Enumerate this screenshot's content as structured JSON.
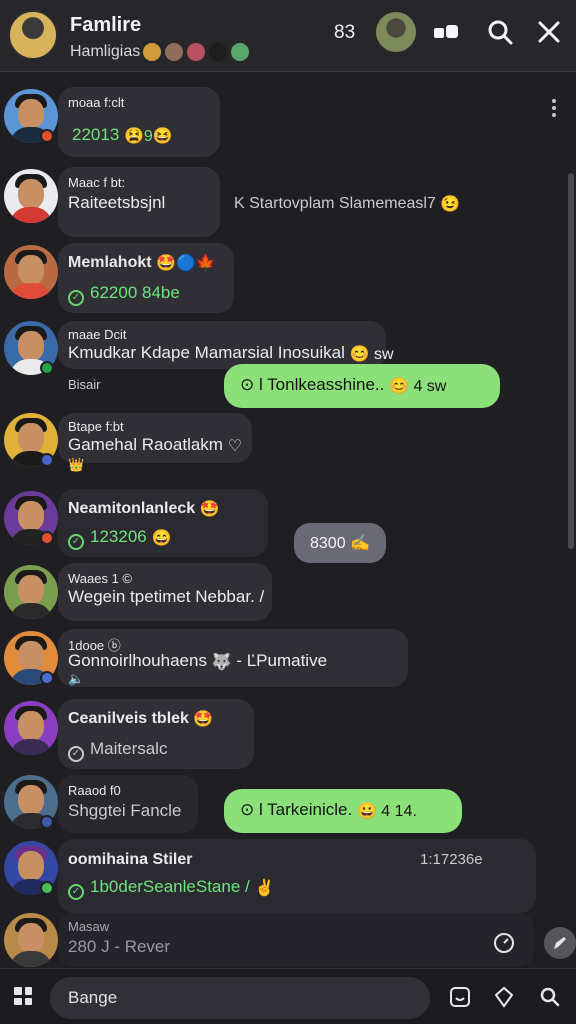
{
  "header": {
    "title": "Famlire",
    "subtitle": "Hamligias",
    "count": "83",
    "member_colors": [
      "#d09a3b",
      "#8e6d5a",
      "#b8505f",
      "#1e1e1e",
      "#59a86b"
    ],
    "icons": [
      "toggle-icon",
      "search-icon",
      "close-icon"
    ]
  },
  "messages": [
    {
      "sender": "moaa f:clt",
      "text": "22013 ",
      "emoji": "😫9😆",
      "color": "#5b95d6",
      "badge": "#e4502f"
    },
    {
      "sender": "Maac f bt:",
      "text": "Raiteetsbsjnl",
      "side_text": "K Startovplam Slamemeasl7",
      "side_emoji": "😉",
      "color": "#d53a32",
      "badge": ""
    },
    {
      "sender": "Memlahokt",
      "sender_emoji": "🤩🔵🍁",
      "text": "62200 84be",
      "color": "#df4c3a",
      "badge": ""
    },
    {
      "sender": "maae Dcit",
      "text": "Kmudkar Kdape Mamarsial Inosuikal",
      "emoji": "😊 sw",
      "note": "Bisair",
      "color": "#3a6aa8",
      "badge": "#29a04b"
    },
    {
      "sender": "Btape f:bt",
      "text": "Gamehal Raoatlakm",
      "emoji": "♡",
      "note": "👑",
      "color": "#e0b13a",
      "badge": "#4763c9"
    },
    {
      "sender": "Neamitonlanleck",
      "sender_emoji": "🤩",
      "text": "123206 ",
      "emoji": "😄",
      "color": "#6a3c9a",
      "badge": "#e35033"
    },
    {
      "sender": "Waaes 1 ©",
      "text": "Wegein tpetimet Nebbar. /",
      "color": "#7a9e4e",
      "badge": ""
    },
    {
      "sender": "1dooe ⓑ",
      "text": "Gonnoirlhouhaens",
      "emoji": "🐺",
      "suffix": " - ĽPumative",
      "note": "🔈",
      "color": "#e28b3a",
      "badge": "#4c6fd4"
    },
    {
      "sender": "Ceanilveis tblek",
      "sender_emoji": "🤩",
      "text": "Maitersalc",
      "color": "#8a3fc2",
      "badge": ""
    },
    {
      "sender": "Raaod f0",
      "text": "Shggtei Fancle",
      "color": "#4c6d8e",
      "badge": "#3b5ca8"
    },
    {
      "sender": "oomihaina Stiler",
      "text": "1b0derSeanleStane /",
      "emoji": "✌️",
      "time": "1:17236e",
      "color": "#3448a3",
      "badge": "#4bbf56"
    },
    {
      "sender": "Masaw",
      "text": "280 J - Rever",
      "color": "#b88a4a",
      "badge": ""
    }
  ],
  "outgoing": [
    {
      "text": "⊙ l Tonlkeasshine..",
      "emoji": "😊 4 sw"
    },
    {
      "text": "⊙ l Tarkeinicle.",
      "emoji": "😀 4 14."
    }
  ],
  "gray_bubble": {
    "text": "8300 ✍"
  },
  "footer": {
    "search_placeholder": "Bange",
    "icons": [
      "grid-icon",
      "sticker-icon",
      "gem-icon",
      "search-icon"
    ]
  }
}
